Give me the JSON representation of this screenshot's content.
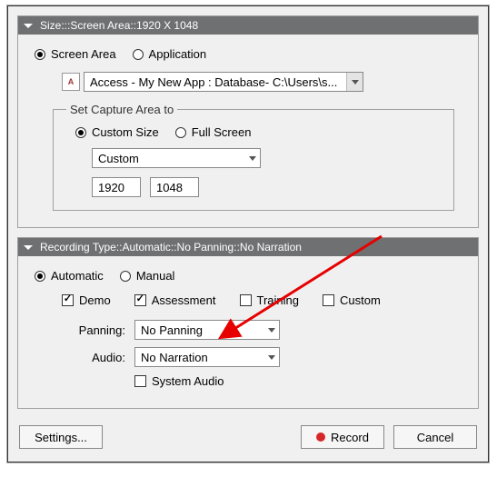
{
  "size_panel": {
    "header": "Size:::Screen Area::1920 X 1048",
    "mode": {
      "screen_area": "Screen Area",
      "application": "Application",
      "selected": "screen_area"
    },
    "app_dropdown": {
      "icon_label": "A",
      "value": "Access - My New App : Database- C:\\Users\\s..."
    },
    "capture_legend": "Set Capture Area to",
    "capture_mode": {
      "custom_size": "Custom Size",
      "full_screen": "Full Screen",
      "selected": "custom_size"
    },
    "preset_dropdown": "Custom",
    "width": "1920",
    "height": "1048"
  },
  "recording_panel": {
    "header": "Recording Type::Automatic::No Panning::No Narration",
    "mode": {
      "automatic": "Automatic",
      "manual": "Manual",
      "selected": "automatic"
    },
    "types": {
      "demo": {
        "label": "Demo",
        "checked": true
      },
      "assessment": {
        "label": "Assessment",
        "checked": true
      },
      "training": {
        "label": "Training",
        "checked": false
      },
      "custom": {
        "label": "Custom",
        "checked": false
      }
    },
    "panning": {
      "label": "Panning:",
      "value": "No Panning"
    },
    "audio": {
      "label": "Audio:",
      "value": "No Narration"
    },
    "system_audio": {
      "label": "System Audio",
      "checked": false
    }
  },
  "buttons": {
    "settings": "Settings...",
    "record": "Record",
    "cancel": "Cancel"
  }
}
